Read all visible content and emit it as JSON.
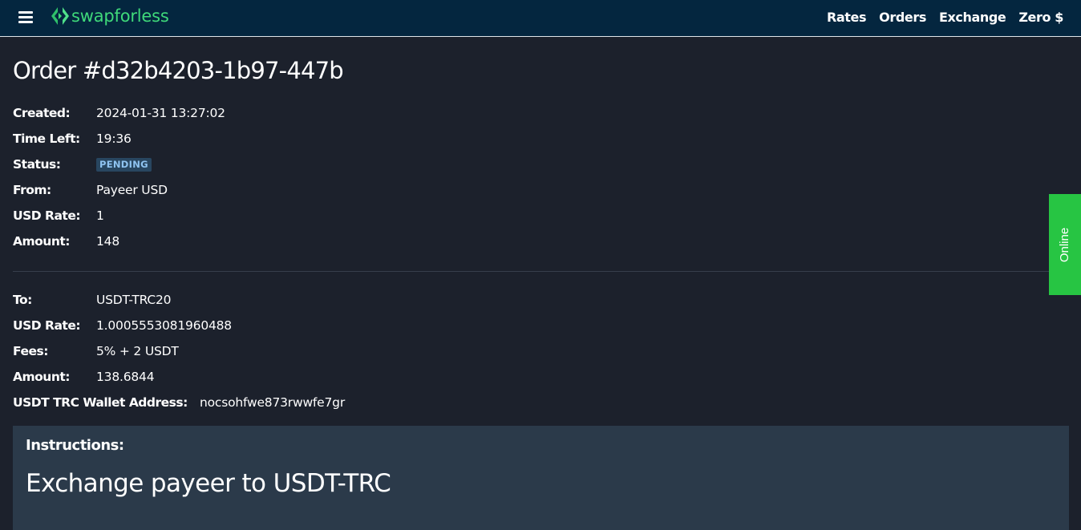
{
  "brand": {
    "name": "swapforless"
  },
  "nav": {
    "links": [
      "Rates",
      "Orders",
      "Exchange",
      "Zero $"
    ]
  },
  "order": {
    "title": "Order #d32b4203-1b97-447b",
    "from_details": [
      {
        "label": "Created:",
        "value": "2024-01-31 13:27:02"
      },
      {
        "label": "Time Left:",
        "value": "19:36"
      },
      {
        "label": "Status:",
        "value": "PENDING"
      },
      {
        "label": "From:",
        "value": "Payeer USD"
      },
      {
        "label": "USD Rate:",
        "value": "1"
      },
      {
        "label": "Amount:",
        "value": "148"
      }
    ],
    "to_details": [
      {
        "label": "To:",
        "value": "USDT-TRC20"
      },
      {
        "label": "USD Rate:",
        "value": "1.0005553081960488"
      },
      {
        "label": "Fees:",
        "value": "5% + 2 USDT"
      },
      {
        "label": "Amount:",
        "value": "138.6844"
      },
      {
        "label": "USDT TRC Wallet Address:",
        "value": "nocsohfwe873rwwfe7gr"
      }
    ]
  },
  "instructions": {
    "label": "Instructions:",
    "heading": "Exchange payeer to USDT-TRC"
  },
  "online_widget": {
    "label": "Online"
  },
  "colors": {
    "navbar_bg": "#04263f",
    "page_bg": "#1c212c",
    "brand_green": "#3fd97a",
    "badge_bg": "#284660",
    "badge_text": "#8fc4f1",
    "instructions_bg": "#2b3a4a",
    "online_green": "#27c543"
  }
}
